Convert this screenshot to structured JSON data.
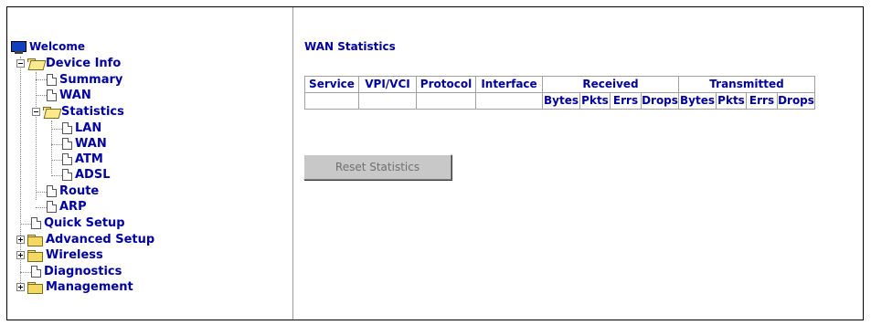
{
  "nav": {
    "welcome": "Welcome",
    "device_info": "Device Info",
    "summary": "Summary",
    "wan": "WAN",
    "statistics": "Statistics",
    "stat_lan": "LAN",
    "stat_wan": "WAN",
    "stat_atm": "ATM",
    "stat_adsl": "ADSL",
    "route": "Route",
    "arp": "ARP",
    "quick_setup": "Quick Setup",
    "advanced_setup": "Advanced Setup",
    "wireless": "Wireless",
    "diagnostics": "Diagnostics",
    "management": "Management"
  },
  "page": {
    "title": "WAN Statistics",
    "reset_button": "Reset Statistics"
  },
  "table": {
    "headers": {
      "service": "Service",
      "vpi_vci": "VPI/VCI",
      "protocol": "Protocol",
      "interface": "Interface",
      "received": "Received",
      "transmitted": "Transmitted"
    },
    "subheaders": {
      "rx_bytes": "Bytes",
      "rx_pkts": "Pkts",
      "rx_errs": "Errs",
      "rx_drops": "Drops",
      "tx_bytes": "Bytes",
      "tx_pkts": "Pkts",
      "tx_errs": "Errs",
      "tx_drops": "Drops"
    }
  }
}
